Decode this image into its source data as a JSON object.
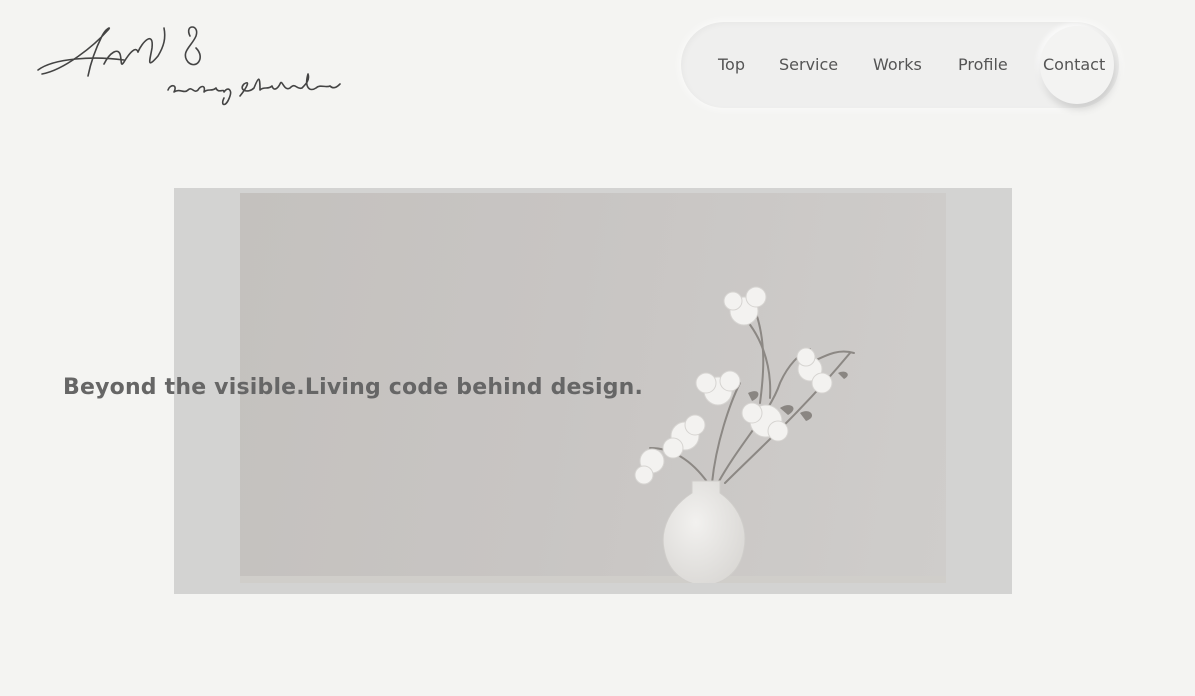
{
  "logo": {
    "name": "And 8",
    "sub": "cording studio"
  },
  "nav": {
    "items": [
      {
        "label": "Top"
      },
      {
        "label": "Service"
      },
      {
        "label": "Works"
      },
      {
        "label": "Profile"
      },
      {
        "label": "Contact"
      }
    ]
  },
  "hero": {
    "tagline": "Beyond the visible.Living code behind design.",
    "image_alt": "white-vase-with-flowers"
  }
}
